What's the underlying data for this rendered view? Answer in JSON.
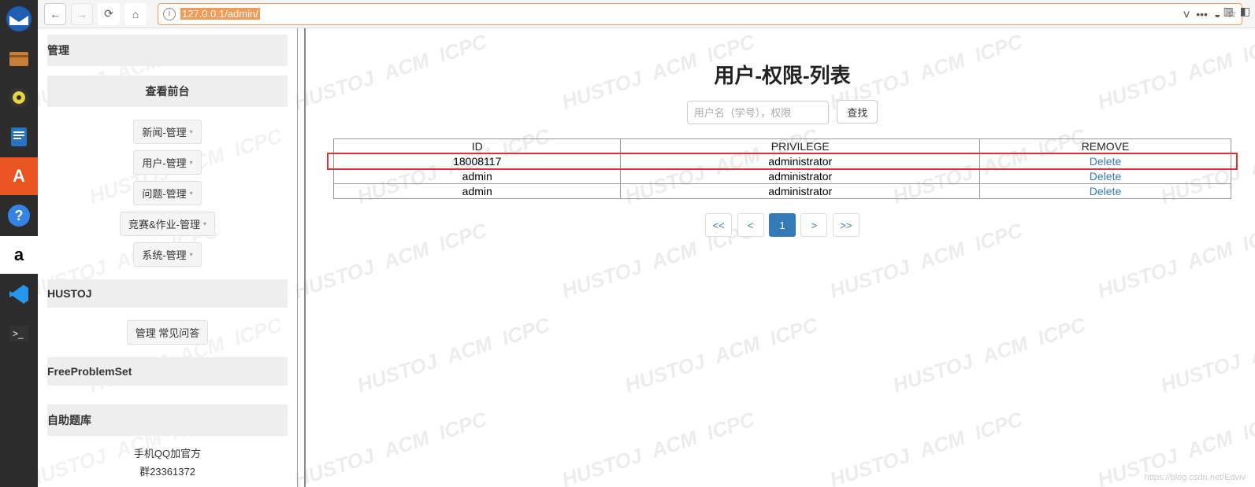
{
  "browser": {
    "url": "127.0.0.1/admin/"
  },
  "dock": {
    "icons": [
      "thunderbird",
      "files",
      "rhythmbox",
      "libreoffice",
      "software",
      "help",
      "amazon",
      "vscode",
      "terminal"
    ]
  },
  "sidebar": {
    "section1_header": "管理",
    "view_front": "查看前台",
    "menu": [
      {
        "label": "新闻-管理"
      },
      {
        "label": "用户-管理"
      },
      {
        "label": "问题-管理"
      },
      {
        "label": "竞赛&作业-管理"
      },
      {
        "label": "系统-管理"
      }
    ],
    "section2_header": "HUSTOJ",
    "faq_btn": "管理 常见问答",
    "section3_header": "FreeProblemSet",
    "section4_header": "自助题库",
    "qq_line1": "手机QQ加官方",
    "qq_line2": "群23361372"
  },
  "main": {
    "title": "用户-权限-列表",
    "search_placeholder": "用户名（学号），权限",
    "search_btn": "查找",
    "columns": [
      "ID",
      "PRIVILEGE",
      "REMOVE"
    ],
    "rows": [
      {
        "id": "18008117",
        "priv": "administrator",
        "remove": "Delete"
      },
      {
        "id": "admin",
        "priv": "administrator",
        "remove": "Delete"
      },
      {
        "id": "admin",
        "priv": "administrator",
        "remove": "Delete"
      }
    ],
    "pager": {
      "first": "<<",
      "prev": "<",
      "page": "1",
      "next": ">",
      "last": ">>"
    }
  },
  "footer_mark": "https://blog.csdn.net/Edviv"
}
